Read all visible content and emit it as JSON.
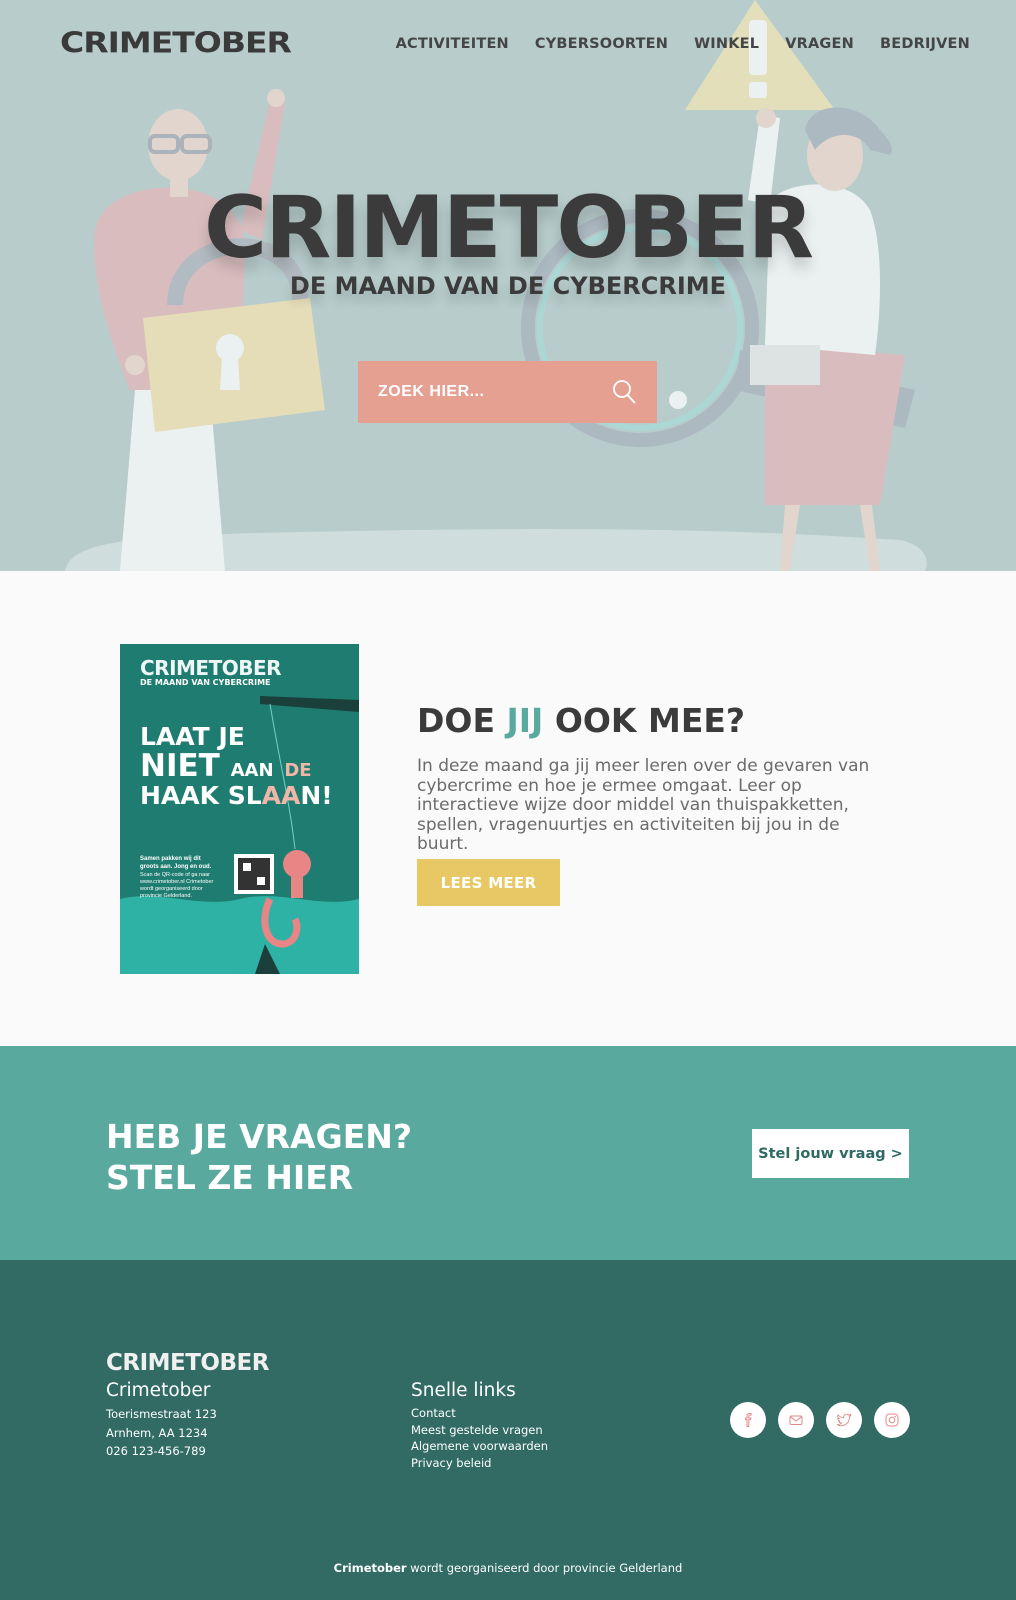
{
  "brand": {
    "logo_text": "CRIMETOBER"
  },
  "nav": {
    "items": [
      {
        "label": "ACTIVITEITEN"
      },
      {
        "label": "CYBERSOORTEN"
      },
      {
        "label": "WINKEL"
      },
      {
        "label": "VRAGEN"
      },
      {
        "label": "BEDRIJVEN"
      }
    ]
  },
  "hero": {
    "title": "CRIMETOBER",
    "subtitle": "DE MAAND VAN DE CYBERCRIME",
    "search_placeholder": "ZOEK HIER...",
    "search_icon": "search-icon"
  },
  "join": {
    "poster": {
      "logo": "CRIMETOBER",
      "subtitle": "DE MAAND VAN CYBERCRIME",
      "line1": "LAAT JE",
      "line2": "NIET",
      "line2_small": "AAN",
      "line2_small2": "DE",
      "line3": "HAAK SL",
      "line3_pink": "AA",
      "line3_end": "N!",
      "small_bold": "Samen pakken wij dit groots aan. Jong en oud.",
      "small_text": "Scan de QR-code of ga naar www.crimetober.nl Crimetober wordt georganiseerd door provincie Gelderland."
    },
    "title_part1": "DOE ",
    "title_accent": "JIJ",
    "title_part2": " OOK MEE?",
    "text": "In deze maand ga jij meer leren over de gevaren van cybercrime en hoe je ermee omgaat. Leer op interactieve wijze door middel van thuispakketten, spellen, vragenuurtjes en activiteiten bij jou in de buurt.",
    "button": "LEES MEER"
  },
  "questions": {
    "line1": "HEB JE VRAGEN?",
    "line2": "STEL ZE HIER",
    "button": "Stel jouw vraag >"
  },
  "footer": {
    "logo_text": "CRIMETOBER",
    "contact": {
      "title": "Crimetober",
      "address": "Toerismestraat 123",
      "city": "Arnhem, AA 1234",
      "phone": "026 123-456-789"
    },
    "links": {
      "title": "Snelle links",
      "items": [
        {
          "label": "Contact"
        },
        {
          "label": "Meest gestelde vragen"
        },
        {
          "label": "Algemene voorwaarden"
        },
        {
          "label": "Privacy beleid"
        }
      ]
    },
    "social": [
      {
        "icon": "facebook-icon"
      },
      {
        "icon": "mail-icon"
      },
      {
        "icon": "twitter-icon"
      },
      {
        "icon": "instagram-icon"
      }
    ],
    "note_brand": "Crimetober",
    "note_text": " wordt georganiseerd door provincie Gelderland"
  },
  "colors": {
    "hero_bg": "#b8cccb",
    "search_bg": "#e5a092",
    "accent_teal": "#5aa99e",
    "button_yellow": "#e8c865",
    "footer_bg": "#316b64",
    "text_dark": "#3b3b3b"
  }
}
